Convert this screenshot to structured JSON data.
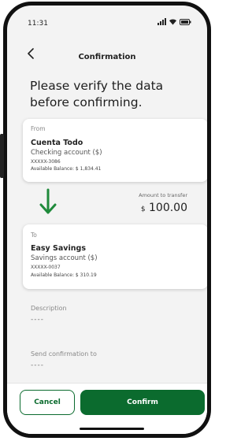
{
  "status_bar": {
    "time": "11:31",
    "icons": [
      "signal-icon",
      "wifi-icon",
      "battery-icon"
    ]
  },
  "header": {
    "back_icon": "chevron-left-icon",
    "title": "Confirmation"
  },
  "heading": "Please verify the data before confirming.",
  "from_account": {
    "label": "From",
    "name": "Cuenta Todo",
    "type": "Checking account ($)",
    "number": "XXXXX-3086",
    "balance": "Available Balance: $ 1,834.41"
  },
  "transfer": {
    "arrow_icon": "arrow-down-icon",
    "amount_label": "Amount to transfer",
    "currency_symbol": "$",
    "amount": "100.00"
  },
  "to_account": {
    "label": "To",
    "name": "Easy Savings",
    "type": "Savings account ($)",
    "number": "XXXXX-0037",
    "balance": "Available Balance: $ 310.19"
  },
  "description": {
    "label": "Description",
    "value": "----"
  },
  "send_confirmation": {
    "label": "Send confirmation to",
    "value": "----"
  },
  "actions": {
    "cancel_label": "Cancel",
    "confirm_label": "Confirm"
  },
  "colors": {
    "accent": "#0b6b2e",
    "arrow": "#1f8a3b",
    "background": "#f3f3f3"
  }
}
